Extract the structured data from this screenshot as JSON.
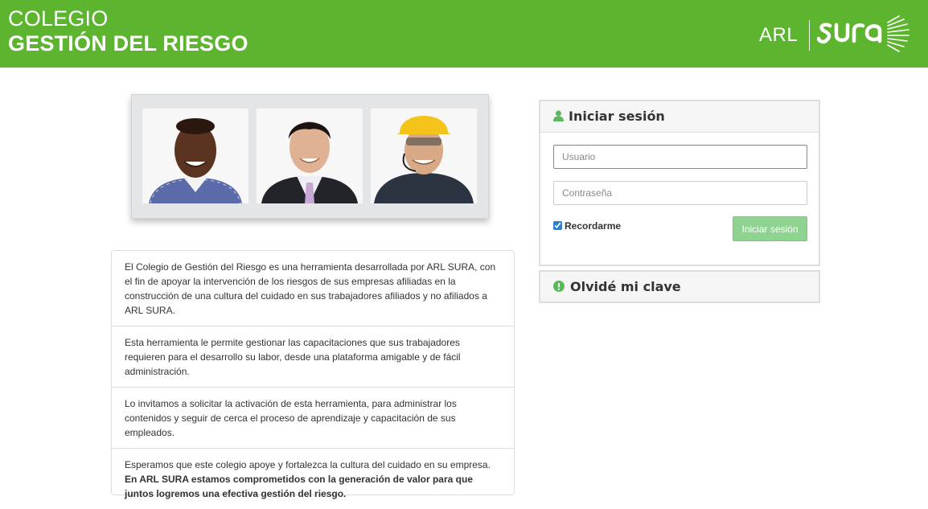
{
  "header": {
    "title_line1": "COLEGIO",
    "title_line2": "GESTIÓN DEL RIESGO",
    "logo_prefix": "ARL",
    "logo_brand": "SURA",
    "color": "#5db42f"
  },
  "info": {
    "p1": "El Colegio de Gestión del Riesgo es una herramienta desarrollada por ARL SURA, con el fin de apoyar la intervención de los riesgos de sus empresas afiliadas en la construcción de una cultura del cuidado en sus trabajadores afiliados y no afiliados a ARL SURA.",
    "p2": "Esta herramienta le permite gestionar las capacitaciones que sus trabajadores requieren para el desarrollo su labor, desde una plataforma amigable y de fácil administración.",
    "p3": "Lo invitamos a solicitar la activación de esta herramienta, para administrar los contenidos y seguir de cerca el proceso de aprendizaje y capacitación de sus empleados.",
    "p4_normal": "Esperamos que este colegio apoye y fortalezca la cultura del cuidado en su empresa.",
    "p4_bold": "En ARL SURA estamos comprometidos con la generación de valor para que juntos logremos una efectiva gestión del riesgo."
  },
  "login": {
    "title": "Iniciar sesión",
    "icon": "user-icon",
    "user_placeholder": "Usuario",
    "password_placeholder": "Contraseña",
    "remember_label": "Recordarme",
    "remember_checked": true,
    "button_label": "Iniciar sesión"
  },
  "forgot": {
    "label": "Olvidé mi clave",
    "icon": "exclamation-circle-icon"
  },
  "photos": {
    "icons": [
      "person-photo",
      "person-photo",
      "worker-photo"
    ]
  }
}
